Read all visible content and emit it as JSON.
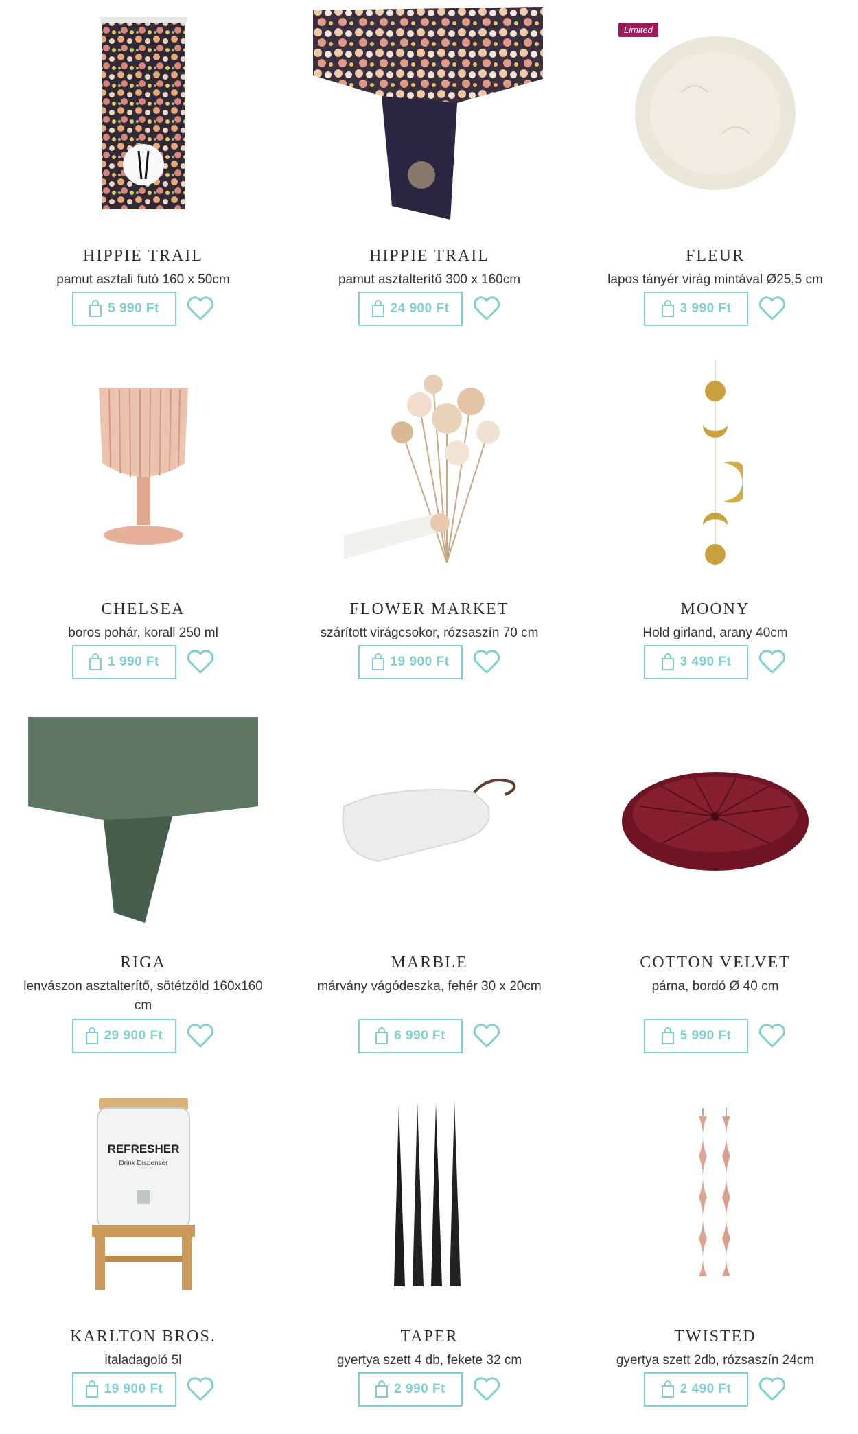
{
  "products": [
    {
      "title": "HIPPIE TRAIL",
      "subtitle": "pamut asztali futó 160 x 50cm",
      "price": "5 990 Ft",
      "badge": ""
    },
    {
      "title": "HIPPIE TRAIL",
      "subtitle": "pamut asztalterítő 300 x 160cm",
      "price": "24 900 Ft",
      "badge": ""
    },
    {
      "title": "FLEUR",
      "subtitle": "lapos tányér virág mintával Ø25,5 cm",
      "price": "3 990 Ft",
      "badge": "Limited"
    },
    {
      "title": "CHELSEA",
      "subtitle": "boros pohár, korall 250 ml",
      "price": "1 990 Ft",
      "badge": ""
    },
    {
      "title": "FLOWER MARKET",
      "subtitle": "szárított virágcsokor, rózsaszín 70 cm",
      "price": "19 900 Ft",
      "badge": ""
    },
    {
      "title": "MOONY",
      "subtitle": "Hold girland, arany 40cm",
      "price": "3 490 Ft",
      "badge": ""
    },
    {
      "title": "RIGA",
      "subtitle": "lenvászon asztalterítő, sötétzöld 160x160 cm",
      "price": "29 900 Ft",
      "badge": ""
    },
    {
      "title": "MARBLE",
      "subtitle": "márvány vágódeszka, fehér 30 x 20cm",
      "price": "6 990 Ft",
      "badge": ""
    },
    {
      "title": "COTTON VELVET",
      "subtitle": "párna, bordó Ø 40 cm",
      "price": "5 990 Ft",
      "badge": ""
    },
    {
      "title": "KARLTON BROS.",
      "subtitle": "italadagoló 5l",
      "price": "19 900 Ft",
      "badge": ""
    },
    {
      "title": "TAPER",
      "subtitle": "gyertya szett 4 db, fekete 32 cm",
      "price": "2 990 Ft",
      "badge": ""
    },
    {
      "title": "TWISTED",
      "subtitle": "gyertya szett 2db, rózsaszín 24cm",
      "price": "2 490 Ft",
      "badge": ""
    }
  ],
  "dispenser_label": {
    "brand": "REFRESHER",
    "sub": "Drink Dispenser"
  },
  "colors": {
    "accent": "#7fcfcf",
    "badge": "#9b1b5a"
  },
  "icons": {
    "cart": "shopping-bag-icon",
    "wishlist": "heart-icon"
  }
}
